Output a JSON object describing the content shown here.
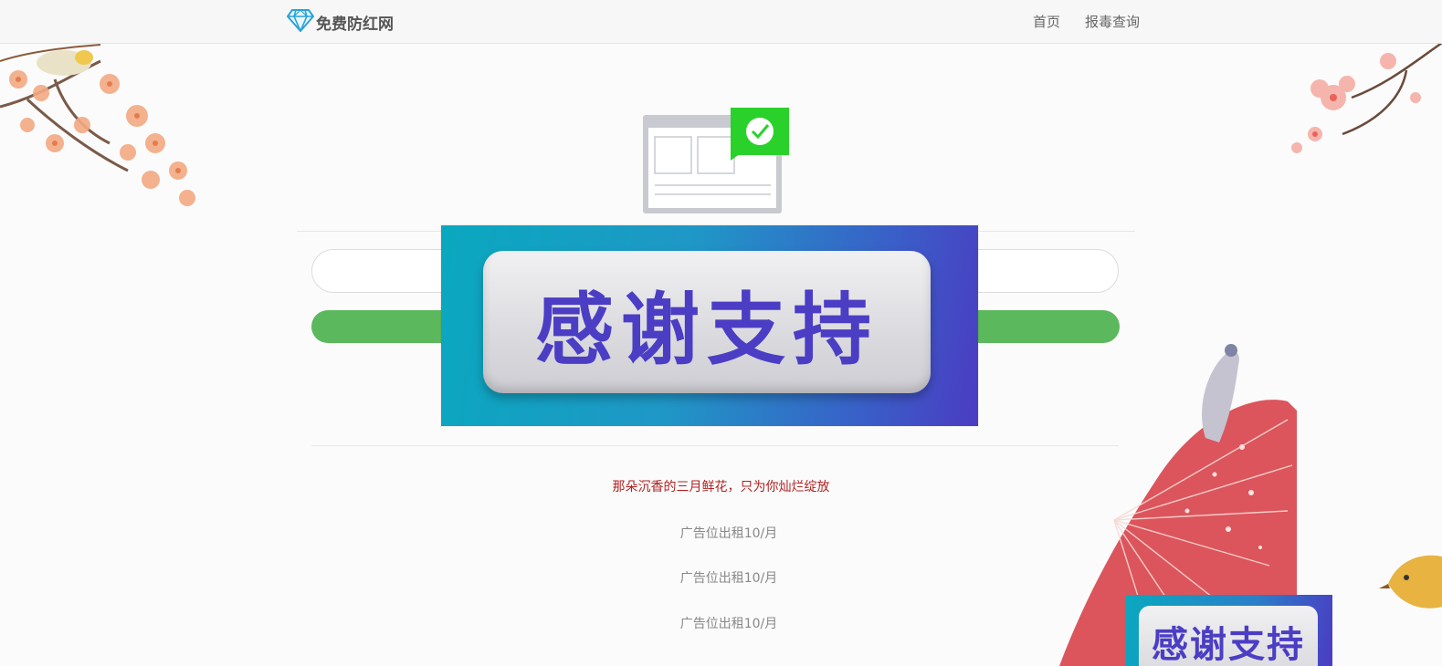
{
  "brand": {
    "name": "免费防红网",
    "icon": "diamond-icon"
  },
  "nav": {
    "items": [
      {
        "label": "首页"
      },
      {
        "label": "报毒查询"
      }
    ]
  },
  "hero": {
    "icon": "browser-check-icon"
  },
  "form": {
    "input_value": "",
    "input_placeholder": "",
    "submit_label": ""
  },
  "popup": {
    "text": "感谢支持"
  },
  "slogan": "那朵沉香的三月鲜花，只为你灿烂绽放",
  "ads": [
    "广告位出租10/月",
    "广告位出租10/月",
    "广告位出租10/月"
  ],
  "corner_badge": {
    "text": "感谢支持"
  },
  "colors": {
    "accent_green": "#5cb85c",
    "slogan_red": "#b22222",
    "popup_purple": "#4b3dc4",
    "popup_teal": "#0aa8bf"
  }
}
